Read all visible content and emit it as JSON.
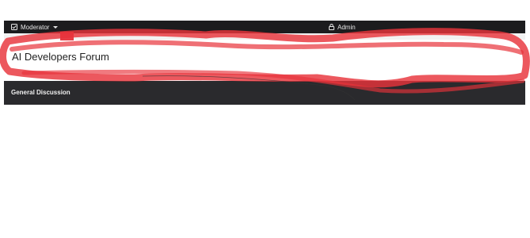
{
  "topbar": {
    "moderator_label": "Moderator",
    "admin_label": "Admin",
    "icons": {
      "moderator": "checkbox-icon",
      "admin": "lock-icon",
      "caret": "caret-down-icon"
    }
  },
  "header": {
    "title": "AI Developers Forum"
  },
  "section": {
    "title": "General Discussion"
  },
  "colors": {
    "topbar_bg": "#1c1c1e",
    "section_bg": "#2a2a2d",
    "annotation_red": "#e8333b"
  }
}
